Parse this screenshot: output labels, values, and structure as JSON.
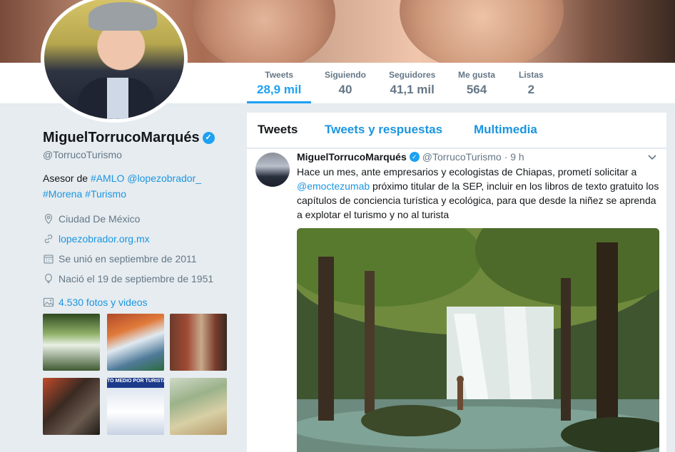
{
  "stats": [
    {
      "label": "Tweets",
      "value": "28,9 mil",
      "active": true
    },
    {
      "label": "Siguiendo",
      "value": "40"
    },
    {
      "label": "Seguidores",
      "value": "41,1 mil"
    },
    {
      "label": "Me gusta",
      "value": "564"
    },
    {
      "label": "Listas",
      "value": "2"
    }
  ],
  "profile": {
    "name": "MiguelTorrucoMarqués",
    "handle": "@TorrucoTurismo",
    "bio_prefix": "Asesor de",
    "bio_tags": [
      "#AMLO",
      "@lopezobrador_",
      "#Morena",
      "#Turismo"
    ],
    "location": "Ciudad De México",
    "website": "lopezobrador.org.mx",
    "joined": "Se unió en septiembre de 2011",
    "born": "Nació el 19 de septiembre de 1951",
    "photos_label": "4.530 fotos y videos"
  },
  "thumb_overlays": {
    "t5": "TO MEDIO POR TURISTA 53"
  },
  "tabs": [
    {
      "label": "Tweets",
      "active": true
    },
    {
      "label": "Tweets y respuestas"
    },
    {
      "label": "Multimedia"
    }
  ],
  "tweet": {
    "name": "MiguelTorrucoMarqués",
    "handle": "@TorrucoTurismo",
    "time": "· 9 h",
    "text_1": "Hace un mes, ante empresarios y ecologistas de Chiapas, prometí solicitar a",
    "mention": "@emoctezumab",
    "text_2": "próximo titular de la SEP, incluir en los libros de texto gratuito los capítulos de conciencia turística y ecológica, para que desde la niñez se aprenda a explotar el turismo y no al turista"
  },
  "colors": {
    "accent": "#1da1f2",
    "link": "#1b95e0",
    "muted": "#657786",
    "bg": "#e6ecf0"
  }
}
